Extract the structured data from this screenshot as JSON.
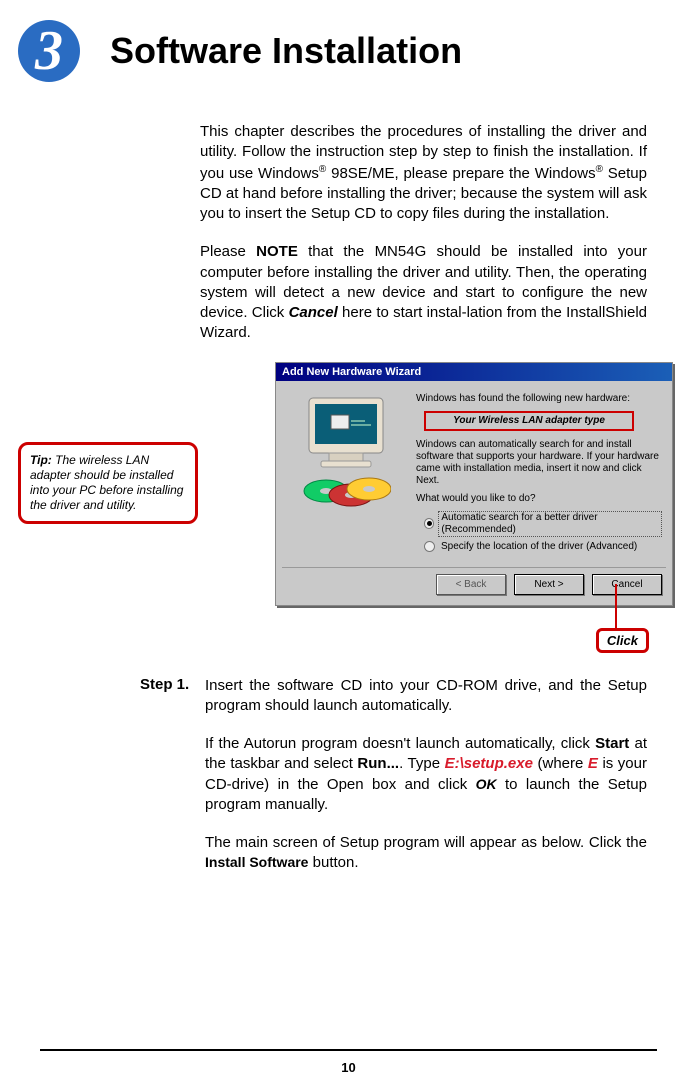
{
  "chapter": {
    "number": "3",
    "title": "Software Installation"
  },
  "intro": {
    "p1_part1": "This chapter describes the procedures of installing the driver and utility.  Follow the instruction step by step to finish the installation.  If you use Windows",
    "p1_sup1": "®",
    "p1_part2": " 98SE/ME, please prepare the Windows",
    "p1_sup2": "®",
    "p1_part3": " Setup CD at hand before installing the driver; because the system will ask you to insert the Setup CD to copy files during the installation.",
    "p2_part1": "Please ",
    "p2_bold": "NOTE",
    "p2_part2": " that the MN54G should be installed into your computer before installing the driver and utility.  Then, the operating system will detect a new device and start to configure the new device.  Click ",
    "p2_italic": "Cancel",
    "p2_part3": " here to start instal-lation from the InstallShield Wizard."
  },
  "tip": {
    "label": "Tip:",
    "text": " The wireless LAN adapter should be installed into your PC before installing the driver and utility."
  },
  "wizard": {
    "title": "Add New Hardware Wizard",
    "line1": "Windows has found the following new hardware:",
    "adapter_label": "Your Wireless LAN adapter type",
    "line2": "Windows can automatically search for and install software that supports your hardware. If your hardware came with installation media, insert it now and click Next.",
    "line3": "What would you like to do?",
    "radio1": "Automatic search for a better driver (Recommended)",
    "radio2": "Specify the location of the driver (Advanced)",
    "btn_back": "< Back",
    "btn_next": "Next >",
    "btn_cancel": "Cancel"
  },
  "click_label": "Click",
  "step1": {
    "label": "Step 1.",
    "p1": "Insert the software CD into your CD-ROM drive, and the Setup program should launch automatically.",
    "p2_part1": "If the Autorun program doesn't launch automatically, click ",
    "p2_b1": "Start",
    "p2_part2": " at the taskbar and select ",
    "p2_b2": "Run...",
    "p2_part3": ".  Type ",
    "p2_red": "E:\\setup.exe",
    "p2_part4": " (where ",
    "p2_red2": "E",
    "p2_part5": " is your CD-drive) in the Open box and click ",
    "p2_it1": "OK",
    "p2_part6": " to launch the Setup program manually.",
    "p3_part1": "The main screen of Setup program will appear as below. Click the ",
    "p3_small": "Install Software",
    "p3_part2": " button."
  },
  "page_number": "10"
}
